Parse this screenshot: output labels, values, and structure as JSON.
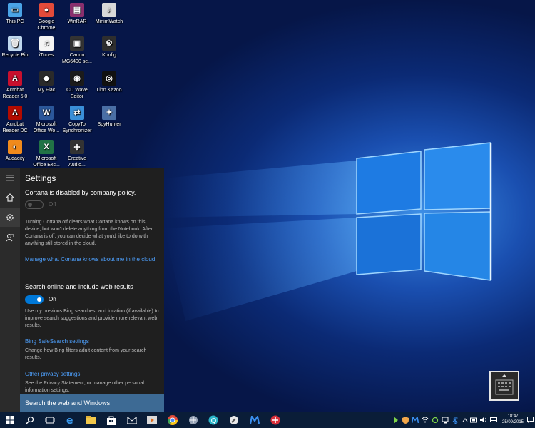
{
  "desktop_icons": [
    {
      "label": "This PC",
      "color": "#4aa3e6",
      "glyph": "▭"
    },
    {
      "label": "Google Chrome",
      "color": "#e34b3a",
      "glyph": "●"
    },
    {
      "label": "WinRAR",
      "color": "#8a2f6e",
      "glyph": "▤"
    },
    {
      "label": "MinimWatch",
      "color": "#d8d8d8",
      "glyph": "♪"
    },
    {
      "label": "Recycle Bin",
      "color": "#c0d8ee",
      "glyph": "🗑"
    },
    {
      "label": "iTunes",
      "color": "#f4f4f4",
      "glyph": "♫"
    },
    {
      "label": "Canon MG6400 se...",
      "color": "#333333",
      "glyph": "▣"
    },
    {
      "label": "Konfig",
      "color": "#2e2e2e",
      "glyph": "⚙"
    },
    {
      "label": "Acrobat Reader 5.0",
      "color": "#c8102e",
      "glyph": "A"
    },
    {
      "label": "My Flac",
      "color": "#2a2a2a",
      "glyph": "◆"
    },
    {
      "label": "CD Wave Editor",
      "color": "#1b1b1b",
      "glyph": "◉"
    },
    {
      "label": "Linn Kazoo",
      "color": "#111111",
      "glyph": "◎"
    },
    {
      "label": "Acrobat Reader DC",
      "color": "#b30b00",
      "glyph": "A"
    },
    {
      "label": "Microsoft Office Wo...",
      "color": "#2b579a",
      "glyph": "W"
    },
    {
      "label": "CopyTo Synchronizer",
      "color": "#3a8fd8",
      "glyph": "⇄"
    },
    {
      "label": "SpyHunter",
      "color": "#4a6fa5",
      "glyph": "✦"
    },
    {
      "label": "Audacity",
      "color": "#f08a1c",
      "glyph": "◐"
    },
    {
      "label": "Microsoft Office Exc...",
      "color": "#217346",
      "glyph": "X"
    },
    {
      "label": "Creative Audio...",
      "color": "#333333",
      "glyph": "◈"
    }
  ],
  "panel": {
    "menu_icon": "hamburger-icon",
    "rail_icons": [
      "home-icon",
      "gear-icon",
      "feedback-icon"
    ],
    "title": "Settings",
    "policy_text": "Cortana is disabled by company policy.",
    "cortana_toggle": {
      "state": "Off",
      "enabled": false
    },
    "cortana_desc": "Turning Cortana off clears what Cortana knows on this device, but won't delete anything from the Notebook. After Cortana is off, you can decide what you'd like to do with anything still stored in the cloud.",
    "manage_link": "Manage what Cortana knows about me in the cloud",
    "web_heading": "Search online and include web results",
    "web_toggle": {
      "state": "On",
      "enabled": true
    },
    "web_desc": "Use my previous Bing searches, and location (if available) to improve search suggestions and provide more relevant web results.",
    "safesearch_link": "Bing SafeSearch settings",
    "safesearch_desc": "Change how Bing filters adult content from your search results.",
    "privacy_link": "Other privacy settings",
    "privacy_desc": "See the Privacy Statement, or manage other personal information settings."
  },
  "search": {
    "placeholder": "Search the web and Windows"
  },
  "taskbar": {
    "items": [
      "start-icon",
      "search-icon",
      "task-view-icon",
      "edge-icon",
      "file-explorer-icon",
      "store-icon",
      "mail-icon",
      "media-player-icon",
      "chrome-icon",
      "network-tool-icon",
      "search-app-icon",
      "wrench-icon",
      "malwarebytes-icon",
      "winrar-app-icon"
    ],
    "tray": [
      "winamp-icon",
      "shield-icon",
      "malwarebytes-tray-icon",
      "wifi-tray-icon",
      "sync-tray-icon",
      "network-tray-icon",
      "bluetooth-tray-icon",
      "chevron-up-icon",
      "battery-icon",
      "volume-icon",
      "keyboard-icon"
    ],
    "time": "18:47",
    "date": "25/09/2015",
    "notification_icon": "action-center-icon"
  },
  "tablet_widget": {
    "icon": "touch-keyboard-icon"
  },
  "colors": {
    "accent": "#0078d7",
    "panel_bg": "#1f1f1f",
    "link": "#4ea1ff",
    "searchbox": "#3d6a94",
    "taskbar": "#0a1d38"
  }
}
